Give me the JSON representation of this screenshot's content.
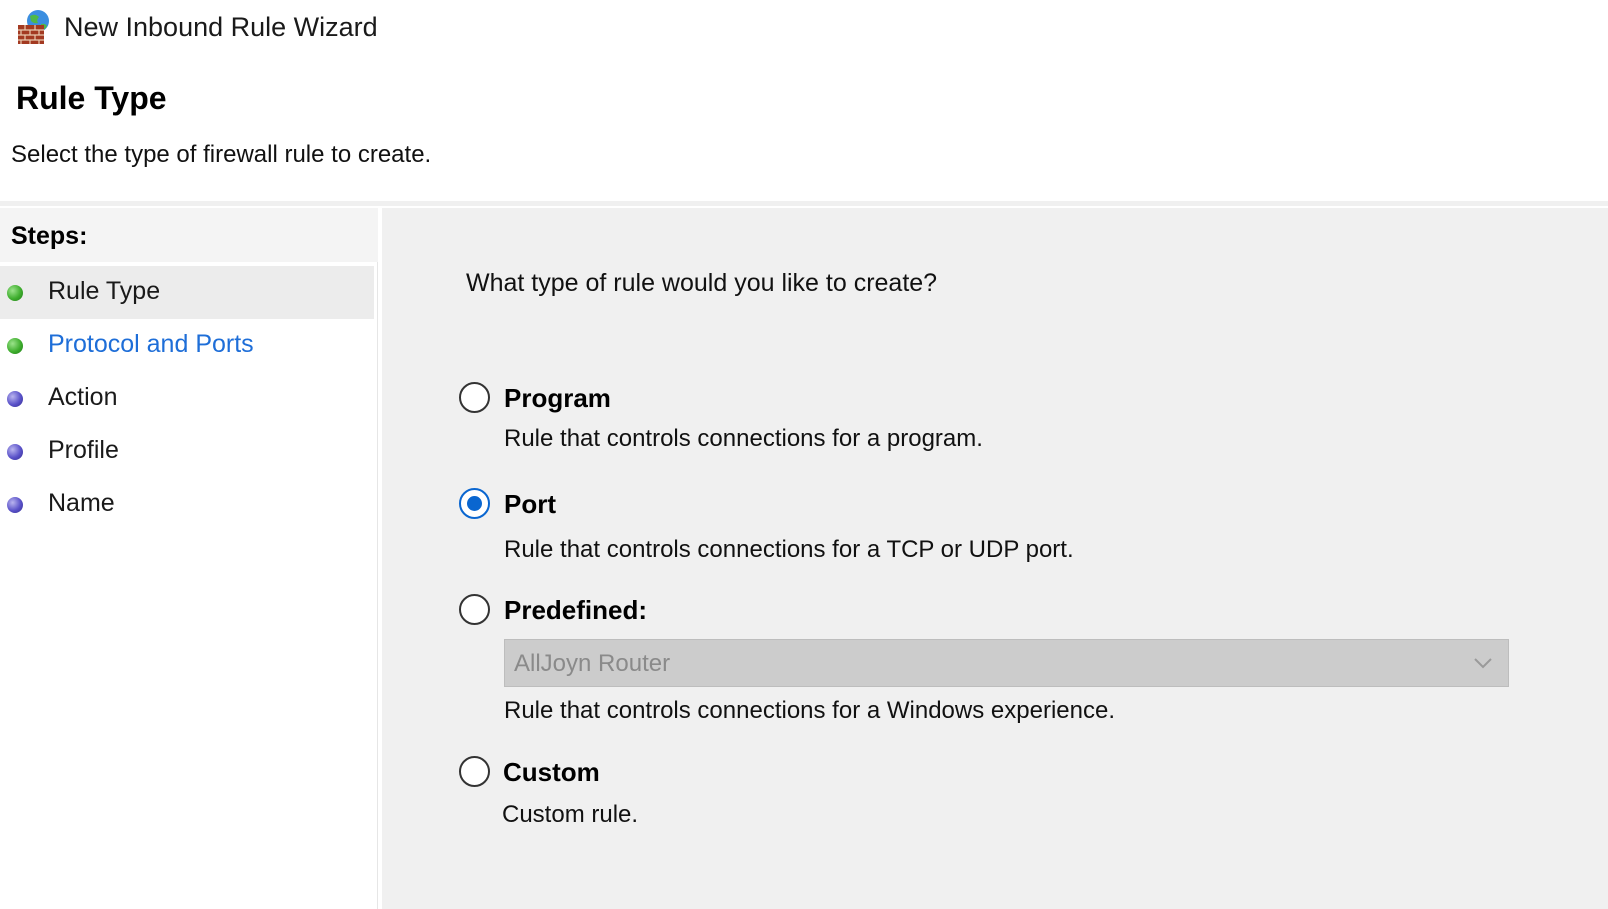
{
  "window": {
    "title": "New Inbound Rule Wizard",
    "icon": "firewall-globe-icon"
  },
  "header": {
    "title": "Rule Type",
    "subtitle": "Select the type of firewall rule to create."
  },
  "steps": {
    "heading": "Steps:",
    "items": [
      {
        "label": "Rule Type",
        "status": "green",
        "active": true
      },
      {
        "label": "Protocol and Ports",
        "status": "green",
        "active": false
      },
      {
        "label": "Action",
        "status": "purple",
        "active": false
      },
      {
        "label": "Profile",
        "status": "purple",
        "active": false
      },
      {
        "label": "Name",
        "status": "purple",
        "active": false
      }
    ]
  },
  "main": {
    "question": "What type of rule would you like to create?",
    "selected": "Port",
    "options": [
      {
        "label": "Program",
        "description": "Rule that controls connections for a program."
      },
      {
        "label": "Port",
        "description": "Rule that controls connections for a TCP or UDP port."
      },
      {
        "label": "Predefined:",
        "description": "Rule that controls connections for a Windows experience."
      },
      {
        "label": "Custom",
        "description": "Custom rule."
      }
    ],
    "predefined_select": {
      "value": "AllJoyn Router",
      "disabled": true
    }
  },
  "colors": {
    "accent": "#0a66d0",
    "link": "#1e6ed8",
    "step_done": "#3fae2e",
    "step_pending": "#5a52c9"
  }
}
